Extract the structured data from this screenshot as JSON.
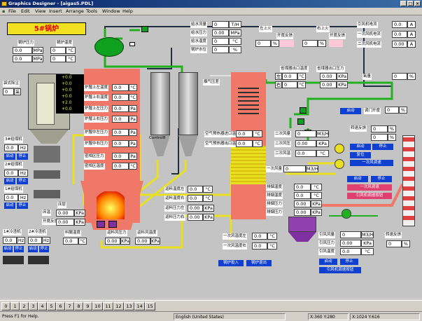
{
  "window": {
    "title": "Graphics Designer - [aigas5.PDL]"
  },
  "menu": [
    "File",
    "Edit",
    "View",
    "Insert",
    "Arrange",
    "Tools",
    "Window",
    "Help"
  ],
  "boiler_title": "5#锅炉",
  "steam": {
    "pressure_label": "锅炉压力",
    "temp_label": "锅炉温度",
    "p_val": "0.0",
    "p_unit": "MPa",
    "t_val": "0",
    "t_unit": "°C"
  },
  "feedwater": {
    "flow_label": "给水流量",
    "flow_val": "0",
    "flow_unit": "T/H",
    "pres_label": "给水压力",
    "pres_val": "0.00",
    "pres_unit": "MPa",
    "temp_label": "给水温度",
    "temp_val": "0",
    "temp_unit": "°C",
    "level_label": "锅炉水位",
    "level_val": "0",
    "level_unit": "%"
  },
  "valves_top": {
    "left_title": "左上火",
    "right_title": "右上火",
    "left_fb_label": "开度反馈",
    "right_fb_label": "开度反馈",
    "left_val": "0",
    "right_val": "0",
    "pct": "%"
  },
  "fans_current": [
    {
      "label": "引风机电流",
      "val": "0.0",
      "unit": "A"
    },
    {
      "label": "一次风机电流",
      "val": "0.0",
      "unit": "A"
    },
    {
      "label": "二次风机电流",
      "val": "0.00",
      "unit": "A"
    }
  ],
  "bag": {
    "label": "袋式除尘",
    "val": "0",
    "unit": "采",
    "left_side": "左",
    "right_side": "右",
    "plus": [
      "+0.0",
      "+0.0",
      "+0.0",
      "+0.0",
      "+2.0",
      "+0.0"
    ]
  },
  "furnace_readings": [
    {
      "label": "炉膛上左温度",
      "val": "0.0",
      "unit": "°C"
    },
    {
      "label": "炉膛上右温度",
      "val": "0.0",
      "unit": "°C"
    },
    {
      "label": "炉膛上左压力",
      "val": "0.0",
      "unit": "Pa"
    },
    {
      "label": "炉膛上右压力",
      "val": "0.0",
      "unit": "Pa"
    },
    {
      "label": "炉膛中左压力",
      "val": "0.0",
      "unit": "Pa"
    },
    {
      "label": "炉膛中右压力",
      "val": "0.0",
      "unit": "Pa"
    },
    {
      "label": "密相区压力",
      "val": "0.0",
      "unit": "Pa"
    },
    {
      "label": "密相区温度",
      "val": "0.0",
      "unit": "°C"
    }
  ],
  "economizer": {
    "out_temp_label": "省煤器出口温度",
    "out_pres_label": "省煤器出口压力",
    "t_top_left": "0.0",
    "t_unit": "°C",
    "p_top": "0.00",
    "p_unit": "KPa",
    "t_bot": "0",
    "p_bot": "0.00",
    "pressure_diff_label": "烟气压差",
    "diff_val": "0",
    "diff_unit": "%"
  },
  "air_preheater": {
    "in_label": "空气预热器进口温度",
    "out_label": "空气预热器出口温度",
    "in_val": "0.0",
    "out_val": "0.0",
    "unit": "°C"
  },
  "secondary_air": [
    {
      "label": "二次风量",
      "val": "0",
      "unit": "M3/H"
    },
    {
      "label": "二次风压",
      "val": "0.00",
      "unit": "KPa"
    },
    {
      "label": "二次风温",
      "val": "0.0",
      "unit": "°C"
    }
  ],
  "primary_air": {
    "label": "一次风量",
    "val": "0",
    "unit": "M3/H"
  },
  "exhaust": [
    {
      "label": "排烟温度",
      "val": "0.0",
      "unit": "°C"
    },
    {
      "label": "排烟温度",
      "val": "0.0",
      "unit": "°C"
    },
    {
      "label": "排烟压力",
      "val": "0.00",
      "unit": "KPa"
    },
    {
      "label": "排烟压力",
      "val": "0.00",
      "unit": "KPa"
    }
  ],
  "oxygen": {
    "label": "氧量",
    "val": "0",
    "unit": "%",
    "door_label": "调门开度",
    "door_val": "0",
    "door_unit": "%"
  },
  "bed": [
    {
      "label": "床温",
      "val": "0.00",
      "unit": "KPa"
    },
    {
      "label": "开度反馈",
      "val": "0.00",
      "unit": "KPa"
    }
  ],
  "bed_label": "床层",
  "hoppers": [
    {
      "label": "3#给煤机",
      "val": "0.0",
      "unit": "Hz"
    },
    {
      "label": "2#给煤机",
      "val": "0.0",
      "unit": "Hz"
    },
    {
      "label": "1#给煤机",
      "val": "0.0",
      "unit": "Hz"
    }
  ],
  "hopper_btns": [
    "启动",
    "停止"
  ],
  "slag": [
    {
      "label": "1#冷渣机",
      "val": "0.0",
      "unit": "Hz"
    },
    {
      "label": "2#冷渣机",
      "val": "0.0",
      "unit": "Hz"
    }
  ],
  "return_air": [
    {
      "label": "料腿温度",
      "val": "0.0",
      "unit": "°C"
    },
    {
      "label": "返料风压力",
      "val": "0.00",
      "unit": "KPa"
    },
    {
      "label": "返料风温度",
      "val": "0.00",
      "unit": "KPa"
    }
  ],
  "return_feed": [
    {
      "label": "返料温度左",
      "val": "0.0",
      "unit": "°C"
    },
    {
      "label": "返料温度右",
      "val": "0.0",
      "unit": "°C"
    },
    {
      "label": "返料压力左",
      "val": "0.00",
      "unit": "KPa"
    },
    {
      "label": "返料压力右",
      "val": "0.00",
      "unit": "KPa"
    }
  ],
  "primary_air_temp": [
    {
      "label": "一次风温度左",
      "val": "0.0",
      "unit": "°C"
    },
    {
      "label": "一次风温度右",
      "val": "0.0",
      "unit": "°C"
    }
  ],
  "induced": {
    "flow_label": "引风风量",
    "flow_val": "0",
    "flow_unit": "M3/H",
    "pres_label": "引风压力",
    "pres_val": "0.00",
    "pres_unit": "KPa",
    "temp_label": "引风温度",
    "temp_val": "0.0",
    "temp_unit": "°C",
    "speed_label": "转速反馈",
    "speed_val": "0",
    "speed_unit": "%"
  },
  "frequency_feedback": {
    "label": "转速反馈",
    "val": "0",
    "unit": "%"
  },
  "control_label": "Control8",
  "blue_buttons": [
    "启动",
    "停止",
    "复位",
    "启动",
    "停止",
    "一次风调速",
    "启动",
    "停止",
    "引风机调速按钮"
  ],
  "control_btns": [
    "锅炉投入",
    "锅炉退出"
  ],
  "pages": [
    "0",
    "1",
    "2",
    "3",
    "4",
    "5",
    "6",
    "7",
    "8",
    "9",
    "10",
    "11",
    "12",
    "13",
    "14",
    "15"
  ],
  "status": {
    "help": "Press F1 for Help.",
    "lang": "English (United States)",
    "pos": "X:360 Y:280",
    "size": "X:1024 Y:616"
  },
  "colors": {
    "furnace": "#f07868",
    "pipe_yellow": "#e8e020",
    "pipe_green": "#20b020",
    "button_blue": "#1040d0",
    "button_pink": "#e04070"
  }
}
